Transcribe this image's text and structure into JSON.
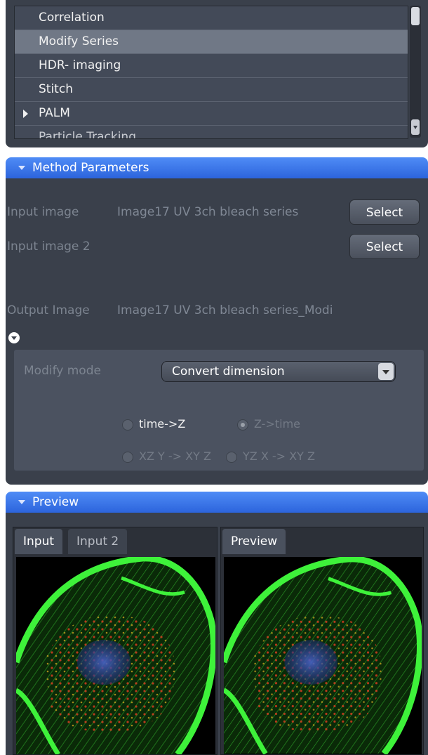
{
  "method_list": {
    "items": [
      {
        "label": "Correlation",
        "selected": false,
        "expandable": false
      },
      {
        "label": "Modify Series",
        "selected": true,
        "expandable": false
      },
      {
        "label": "HDR- imaging",
        "selected": false,
        "expandable": false
      },
      {
        "label": "Stitch",
        "selected": false,
        "expandable": false
      },
      {
        "label": "PALM",
        "selected": false,
        "expandable": true
      },
      {
        "label": "Particle Tracking",
        "selected": false,
        "expandable": false
      }
    ]
  },
  "method_parameters": {
    "header": "Method Parameters",
    "input_image_label": "Input image",
    "input_image_value": "Image17 UV 3ch bleach series",
    "input_image_2_label": "Input image 2",
    "select_label": "Select",
    "output_image_label": "Output Image",
    "output_image_value": "Image17 UV 3ch bleach series_Modi",
    "modify_mode_label": "Modify mode",
    "modify_mode_value": "Convert dimension",
    "options": {
      "time_to_z": "time->Z",
      "z_to_time": "Z->time",
      "xzy_to_xyz": "XZ Y -> XY Z",
      "yzx_to_xyz": "YZ X -> XY Z"
    }
  },
  "preview": {
    "header": "Preview",
    "left_tabs": [
      "Input",
      "Input 2"
    ],
    "right_tabs": [
      "Preview"
    ]
  },
  "colors": {
    "accent_blue": "#3a78ee",
    "panel_bg": "#3a404b",
    "list_selected": "#707886"
  }
}
